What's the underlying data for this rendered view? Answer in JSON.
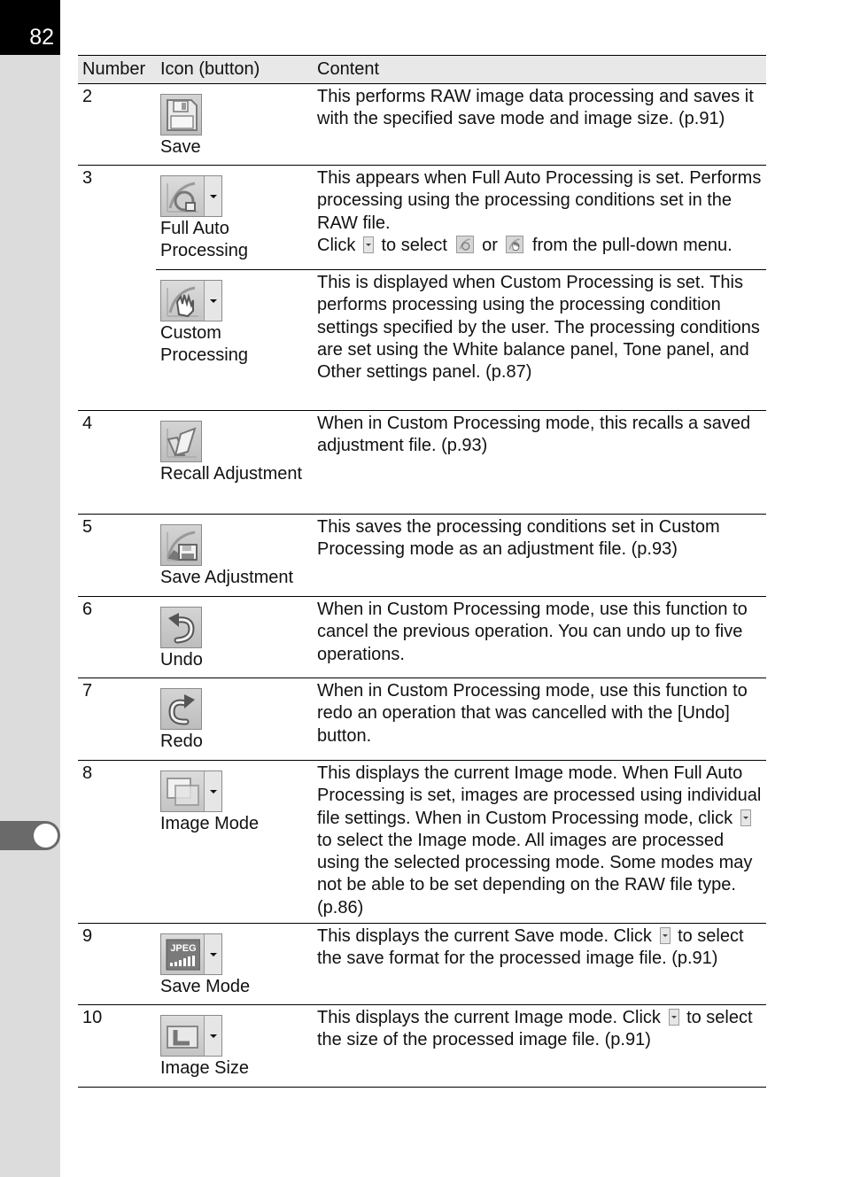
{
  "page": {
    "number": "82"
  },
  "table": {
    "headers": [
      "Number",
      "Icon (button)",
      "Content"
    ],
    "rows": [
      {
        "number": "2",
        "icon": "save-icon",
        "label": "Save",
        "content": "This performs RAW image data processing and saves it with the specified save mode and image size. (p.91)"
      },
      {
        "number": "3",
        "icon": "full-auto-processing-icon",
        "label": "Full Auto Processing",
        "content_lines": [
          "This appears when Full Auto Processing is set. Performs processing using the processing conditions set in the RAW file."
        ],
        "content_click": {
          "prefix": "Click",
          "mid1": "to select",
          "mid2": "or",
          "suffix": "from the pull-down menu."
        }
      },
      {
        "number": "",
        "icon": "custom-processing-icon",
        "label": "Custom Processing",
        "content": "This is displayed when Custom Processing is set. This performs processing using the processing condition settings specified by the user. The processing conditions are set using the White balance panel, Tone panel, and Other settings panel. (p.87)"
      },
      {
        "number": "4",
        "icon": "recall-adjustment-icon",
        "label": "Recall Adjustment",
        "content": "When in Custom Processing mode, this recalls a saved adjustment file. (p.93)"
      },
      {
        "number": "5",
        "icon": "save-adjustment-icon",
        "label": "Save Adjustment",
        "content": "This saves the processing conditions set in Custom Processing mode as an adjustment file. (p.93)"
      },
      {
        "number": "6",
        "icon": "undo-icon",
        "label": "Undo",
        "content": "When in Custom Processing mode, use this function to cancel the previous operation. You can undo up to five operations."
      },
      {
        "number": "7",
        "icon": "redo-icon",
        "label": "Redo",
        "content": "When in Custom Processing mode, use this function to redo an operation that was cancelled with the [Undo] button."
      },
      {
        "number": "8",
        "icon": "image-mode-icon",
        "label": "Image Mode",
        "content_before": "This displays the current Image mode. When Full Auto Processing is set, images are processed using individual file settings. When in Custom Processing mode, click",
        "content_after": "to select the Image mode. All images are processed using the selected processing mode. Some modes may not be able to be set depending on the RAW file type. (p.86)"
      },
      {
        "number": "9",
        "icon": "save-mode-icon",
        "label": "Save Mode",
        "icon_text": "JPEG",
        "content_before": "This displays the current Save mode. Click",
        "content_after": "to select the save format for the processed image file. (p.91)"
      },
      {
        "number": "10",
        "icon": "image-size-icon",
        "label": "Image Size",
        "content_before": "This displays the current Image mode. Click",
        "content_after": "to select the size of the processed image file. (p.91)"
      }
    ]
  }
}
